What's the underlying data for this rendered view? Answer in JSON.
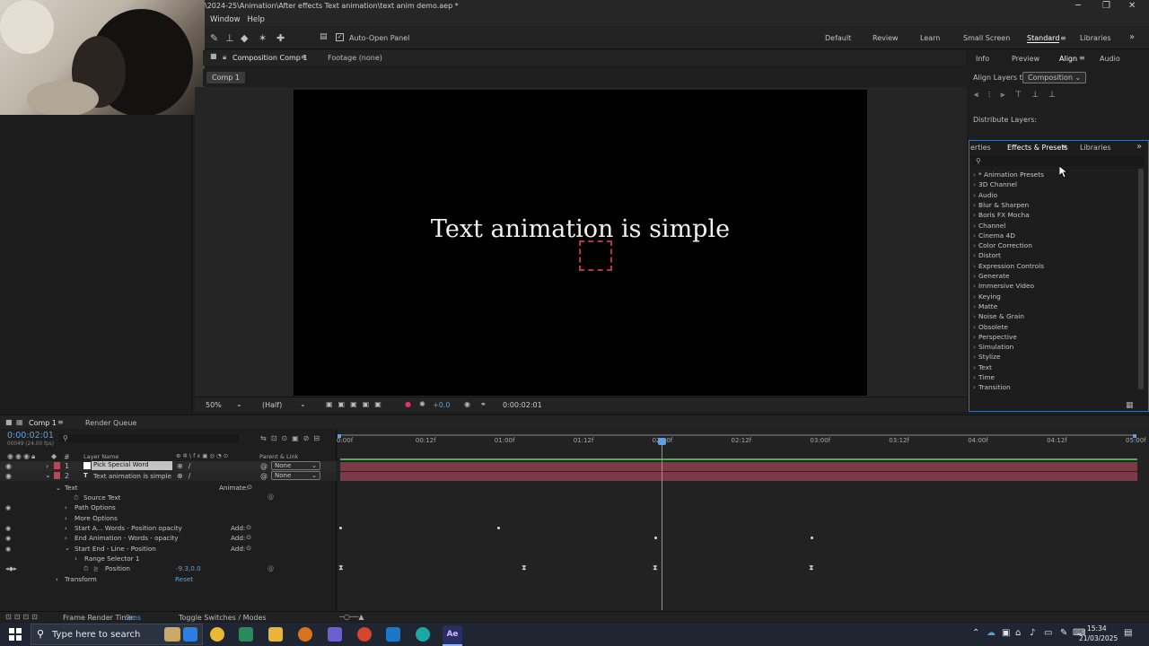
{
  "window": {
    "title": "\\2024-25\\Animation\\After effects Text animation\\text anim demo.aep *",
    "menu": [
      "Window",
      "Help"
    ]
  },
  "toolbar": {
    "auto_open_panel": "Auto-Open Panel",
    "workspaces": [
      "Default",
      "Review",
      "Learn",
      "Small Screen",
      "Standard",
      "Libraries"
    ]
  },
  "composition": {
    "panel_tab": "Composition Comp 1",
    "footage_tab": "Footage (none)",
    "comp_tab": "Comp 1",
    "display_text": "Text animation is simple",
    "zoom": "50%",
    "resolution": "(Half)",
    "exposure": "+0.0",
    "timecode": "0:00:02:01"
  },
  "right_top": {
    "tabs": [
      "Info",
      "Preview",
      "Align",
      "Audio"
    ],
    "align_layers_to_label": "Align Layers to:",
    "align_layers_to_value": "Composition",
    "distribute_label": "Distribute Layers:"
  },
  "effects": {
    "tabs": [
      "erties",
      "Effects & Presets",
      "Libraries"
    ],
    "items": [
      "* Animation Presets",
      "3D Channel",
      "Audio",
      "Blur & Sharpen",
      "Boris FX Mocha",
      "Channel",
      "Cinema 4D",
      "Color Correction",
      "Distort",
      "Expression Controls",
      "Generate",
      "Immersive Video",
      "Keying",
      "Matte",
      "Noise & Grain",
      "Obsolete",
      "Perspective",
      "Simulation",
      "Stylize",
      "Text",
      "Time",
      "Transition"
    ]
  },
  "timeline": {
    "tab": "Comp 1",
    "render_queue": "Render Queue",
    "timecode": "0:00:02:01",
    "frames": "00049 (24.00 fps)",
    "col_layer_name": "Layer Name",
    "col_parent": "Parent & Link",
    "ruler": [
      "0:00f",
      "00:12f",
      "01:00f",
      "01:12f",
      "02:00f",
      "02:12f",
      "03:00f",
      "03:12f",
      "04:00f",
      "04:12f",
      "05:00f"
    ],
    "layers": [
      {
        "num": "1",
        "name": "Pick Special Word",
        "parent": "None"
      },
      {
        "num": "2",
        "name": "Text animation is simple",
        "parent": "None"
      }
    ],
    "props": {
      "text": "Text",
      "animate": "Animate:",
      "source_text": "Source Text",
      "path_options": "Path Options",
      "more_options": "More Options",
      "anim1": "Start A... Words - Position opacity",
      "anim2": "End Animation - Words - opacity",
      "anim3": "Start End - Line - Position",
      "add": "Add:",
      "range_selector": "Range Selector 1",
      "position": "Position",
      "position_value": "-9.3,0.0",
      "transform": "Transform",
      "reset": "Reset"
    },
    "footer_render": "Frame Render Time:",
    "footer_render_val": "2ms",
    "footer_toggle": "Toggle Switches / Modes"
  },
  "taskbar": {
    "search_placeholder": "Type here to search",
    "time": "15:34",
    "date": "21/03/2025"
  }
}
